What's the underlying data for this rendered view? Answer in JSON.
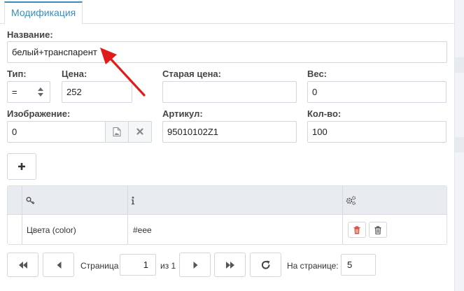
{
  "tabs": [
    {
      "label": "Модификация"
    }
  ],
  "form": {
    "name_label": "Название:",
    "name_value": "белый+транспарент",
    "type_label": "Тип:",
    "type_value": "=",
    "price_label": "Цена:",
    "price_value": "252",
    "old_price_label": "Старая цена:",
    "old_price_value": "",
    "weight_label": "Вес:",
    "weight_value": "0",
    "image_label": "Изображение:",
    "image_value": "0",
    "article_label": "Артикул:",
    "article_value": "95010102Z1",
    "qty_label": "Кол-во:",
    "qty_value": "100"
  },
  "add_button": {
    "icon": "plus-icon"
  },
  "table": {
    "header_icons": [
      "key-icon",
      "info-icon",
      "gears-icon"
    ],
    "rows": [
      {
        "property": "Цвета (color)",
        "value": "#eee"
      }
    ]
  },
  "pager": {
    "page_label": "Страница",
    "page_value": "1",
    "of_label": "из 1",
    "per_page_label": "На странице:",
    "per_page_value": "5"
  },
  "colors": {
    "accent": "#3c8dbc",
    "annotation_arrow": "#e01b1b",
    "delete_icon": "#dd4b39"
  }
}
